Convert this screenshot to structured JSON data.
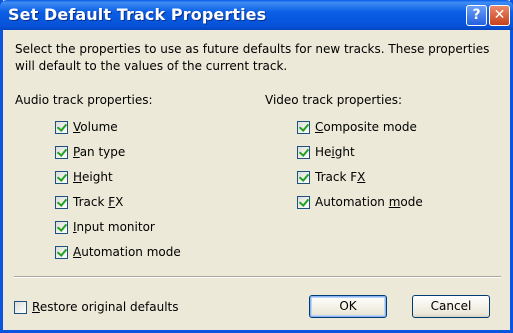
{
  "window": {
    "title": "Set Default Track Properties",
    "help_glyph": "?",
    "close_glyph": "✕",
    "icons": [
      "help-icon",
      "close-icon",
      "check-icon"
    ],
    "colors": {
      "title_bar": "#0a5ae8",
      "body": "#ece9d8",
      "check": "#21a121"
    }
  },
  "description": "Select the properties to use as future defaults for new tracks. These properties will default to the values of the current track.",
  "audio": {
    "label": "Audio track properties:",
    "items": [
      {
        "key": "V",
        "rest": "olume",
        "pre": "",
        "checked": true
      },
      {
        "key": "P",
        "rest": "an type",
        "pre": "",
        "checked": true
      },
      {
        "key": "H",
        "rest": "eight",
        "pre": "",
        "checked": true
      },
      {
        "key": "F",
        "rest": "X",
        "pre": "Track ",
        "checked": true
      },
      {
        "key": "I",
        "rest": "nput monitor",
        "pre": "",
        "checked": true
      },
      {
        "key": "A",
        "rest": "utomation mode",
        "pre": "",
        "checked": true
      }
    ]
  },
  "video": {
    "label": "Video track properties:",
    "items": [
      {
        "key": "C",
        "rest": "omposite mode",
        "pre": "",
        "checked": true
      },
      {
        "key": "i",
        "rest": "ght",
        "pre": "He",
        "checked": true
      },
      {
        "key": "X",
        "rest": "",
        "pre": "Track F",
        "checked": true
      },
      {
        "key": "m",
        "rest": "ode",
        "pre": "Automation ",
        "checked": true
      }
    ]
  },
  "restore": {
    "key": "R",
    "rest": "estore original defaults",
    "pre": "",
    "checked": false
  },
  "buttons": {
    "ok": "OK",
    "cancel": "Cancel"
  }
}
